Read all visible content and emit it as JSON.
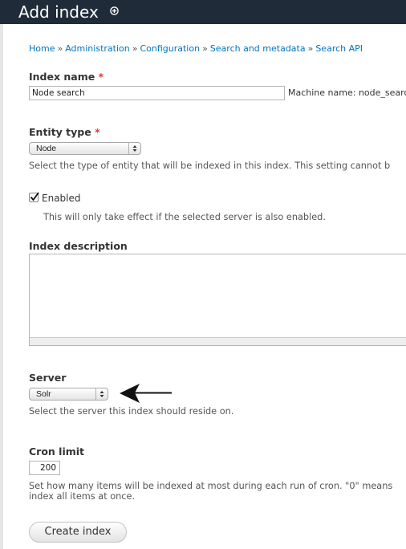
{
  "header": {
    "title": "Add index"
  },
  "breadcrumb": [
    "Home",
    "Administration",
    "Configuration",
    "Search and metadata",
    "Search API"
  ],
  "breadcrumb_separator": "»",
  "required_marker": "*",
  "form": {
    "index_name": {
      "label": "Index name",
      "value": "Node search",
      "machine_name": "Machine name: node_search"
    },
    "entity_type": {
      "label": "Entity type",
      "selected": "Node",
      "description": "Select the type of entity that will be indexed in this index. This setting cannot b"
    },
    "enabled": {
      "label": "Enabled",
      "checked": true,
      "description": "This will only take effect if the selected server is also enabled."
    },
    "index_description": {
      "label": "Index description",
      "value": ""
    },
    "server": {
      "label": "Server",
      "selected": "Solr",
      "description": "Select the server this index should reside on."
    },
    "cron_limit": {
      "label": "Cron limit",
      "value": "200",
      "description_line1": "Set how many items will be indexed at most during each run of cron. \"0\" means",
      "description_line2": "index all items at once."
    },
    "submit_label": "Create index"
  }
}
